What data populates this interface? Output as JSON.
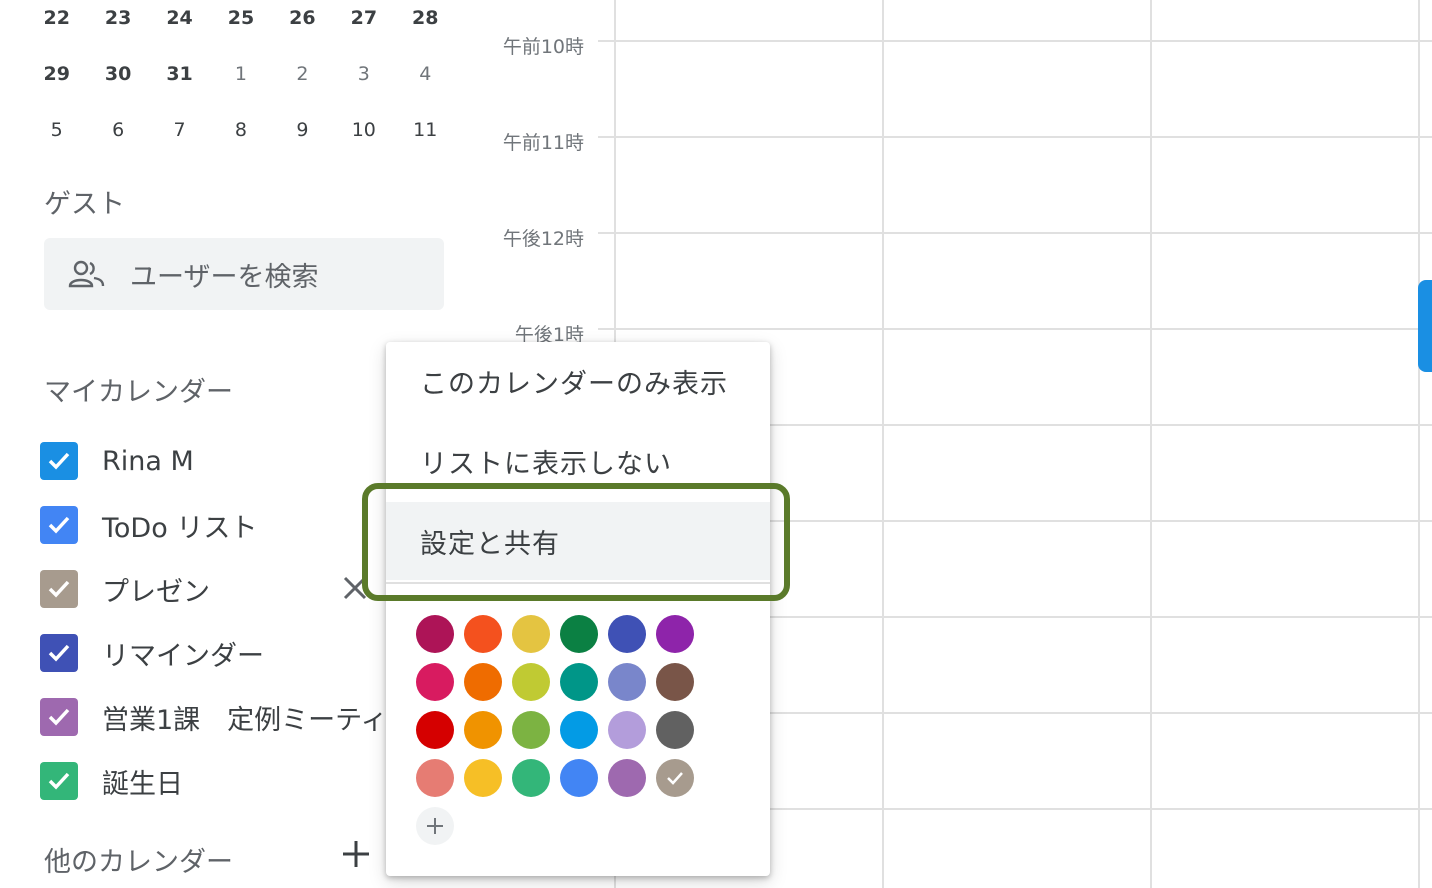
{
  "mini_calendar": {
    "rows": [
      [
        "22",
        "23",
        "24",
        "25",
        "26",
        "27",
        "28"
      ],
      [
        "29",
        "30",
        "31",
        "1",
        "2",
        "3",
        "4"
      ],
      [
        "5",
        "6",
        "7",
        "8",
        "9",
        "10",
        "11"
      ]
    ]
  },
  "guests": {
    "title": "ゲスト",
    "search_placeholder": "ユーザーを検索",
    "icon": "people-icon"
  },
  "my_calendars": {
    "title": "マイカレンダー",
    "items": [
      {
        "label": "Rina M",
        "color": "#1a8fe3",
        "checked": true
      },
      {
        "label": "ToDo リスト",
        "color": "#4285f4",
        "checked": true
      },
      {
        "label": "プレゼン",
        "color": "#a79b8e",
        "checked": true
      },
      {
        "label": "リマインダー",
        "color": "#3f51b5",
        "checked": true
      },
      {
        "label": "営業1課　定例ミーティ",
        "color": "#9e69af",
        "checked": true
      },
      {
        "label": "誕生日",
        "color": "#33b679",
        "checked": true
      }
    ]
  },
  "other_calendars": {
    "title": "他のカレンダー",
    "add_icon": "plus-icon"
  },
  "time_labels": [
    "午前10時",
    "午前11時",
    "午後12時",
    "午後1時"
  ],
  "context_menu": {
    "items": [
      {
        "label": "このカレンダーのみ表示"
      },
      {
        "label": "リストに表示しない"
      },
      {
        "label": "設定と共有"
      }
    ],
    "selected_color": "#a79b8e",
    "colors": [
      [
        "#ad1457",
        "#f4511e",
        "#e4c441",
        "#0b8043",
        "#3f51b5",
        "#8e24aa"
      ],
      [
        "#d81b60",
        "#ef6c00",
        "#c0ca33",
        "#009688",
        "#7986cb",
        "#795548"
      ],
      [
        "#d50000",
        "#f09300",
        "#7cb342",
        "#039be5",
        "#b39ddb",
        "#616161"
      ],
      [
        "#e67c73",
        "#f6bf26",
        "#33b679",
        "#4285f4",
        "#9e69af",
        "#a79b8e"
      ]
    ],
    "add_color_icon": "plus-icon"
  },
  "accent_colors": {
    "highlight": "#5a7a2a",
    "scroll_tab": "#1a8fe3"
  }
}
